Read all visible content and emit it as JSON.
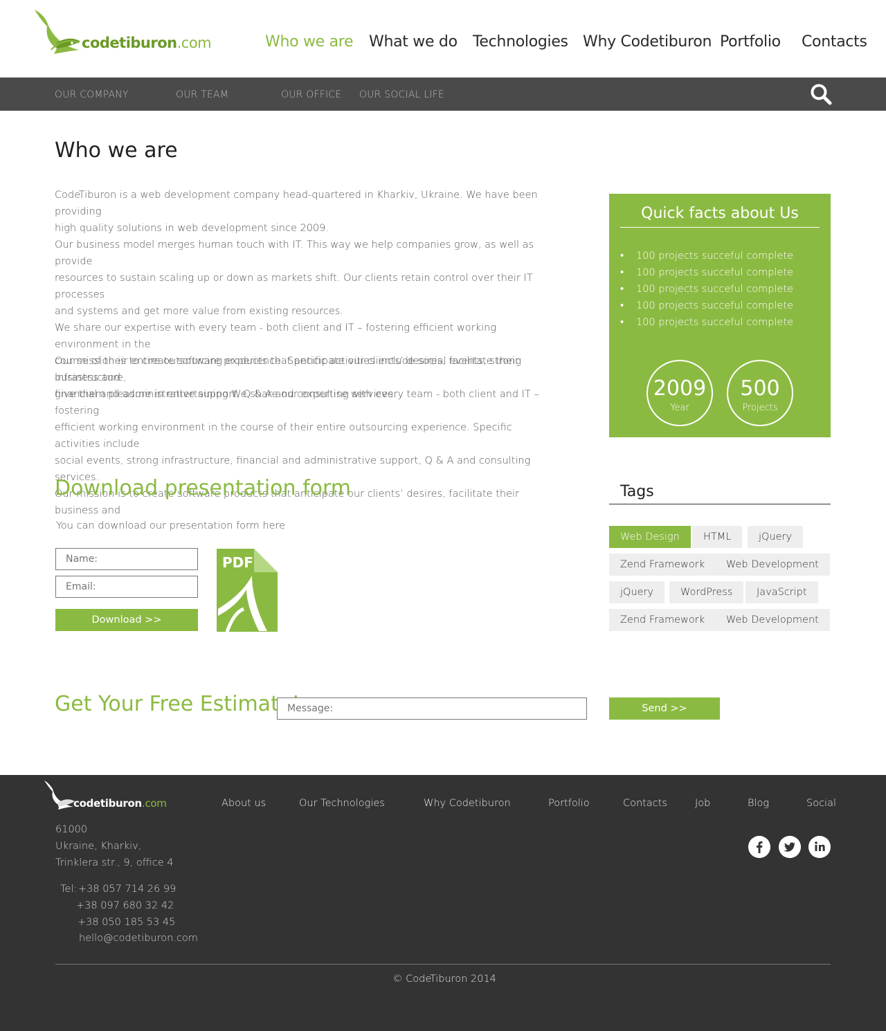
{
  "header": {
    "logo": {
      "bold": "codetiburon",
      "light": ".com"
    },
    "nav": [
      {
        "label": "Who we are",
        "active": true
      },
      {
        "label": "What we do"
      },
      {
        "label": "Technologies"
      },
      {
        "label": "Why Codetiburon"
      },
      {
        "label": "Portfolio"
      },
      {
        "label": "Contacts"
      }
    ]
  },
  "subnav": {
    "items": [
      "OUR COMPANY",
      "OUR TEAM",
      "OUR OFFICE",
      "OUR SOCIAL LIFE"
    ],
    "search_icon": "search-icon"
  },
  "main": {
    "title": "Who we are",
    "paragraphs": [
      [
        "CodeTiburon is a web development company head-quartered in Kharkiv, Ukraine. We have been providing",
        "high quality solutions in web development since 2009."
      ],
      [
        "Our business model merges human touch with IT. This way we help companies grow, as well as provide",
        "resources to sustain scaling up or down as markets shift. Our clients retain control over their IT processes",
        "and systems and get more value from existing resources.",
        "We share our expertise with every team - both client and IT – fostering efficient working environment in the",
        "course of their entire outsourcing experience. Specific activities include social events, strong infrastructure,",
        "financial and administrative support, Q & A and consulting services."
      ],
      [
        "Our mission is to create software products that anticipate our clients’ desires, facilitate their business and",
        "give them pleasure in entertaining.We share our expertise with every team - both client and IT – fostering",
        "efficient working environment in the course of their entire outsourcing experience. Specific activities include",
        "social events, strong infrastructure, financial and administrative support, Q & A and consulting services.",
        "Our mission is to create software products that anticipate our clients’ desires, facilitate their business and"
      ]
    ]
  },
  "facts": {
    "title": "Quick facts about Us",
    "items": [
      "100 projects succeful complete",
      "100 projects succeful complete",
      "100 projects succeful complete",
      "100 projects succeful complete",
      "100 projects succeful complete"
    ],
    "stats": [
      {
        "value": "2009",
        "label": "Year"
      },
      {
        "value": "500",
        "label": "Projects"
      }
    ]
  },
  "download": {
    "title": "Download presentation form",
    "text": "You can download our presentation form  here",
    "name_placeholder": "Name:",
    "email_placeholder": "Email:",
    "button": "Download >>",
    "pdf_label": "PDF"
  },
  "tags": {
    "title": "Tags",
    "items": [
      "Web Design",
      "HTML",
      "jQuery",
      "Zend Framework",
      "Web Development",
      "jQuery",
      "WordPress",
      "JavaScript",
      "Zend Framework",
      "Web Development"
    ],
    "active_index": 0
  },
  "estimate": {
    "title": "Get Your Free Estimate!",
    "message_placeholder": "Message:",
    "button": "Send >>"
  },
  "footer": {
    "logo": {
      "bold": "codetiburon",
      "light": ".com"
    },
    "nav": [
      "About us",
      "Our Technologies",
      "Why Codetiburon",
      "Portfolio",
      "Contacts",
      "Job",
      "Blog",
      "Social"
    ],
    "address": [
      "61000",
      "Ukraine, Kharkiv,",
      "Trinklera str., 9, office 4"
    ],
    "phone_label": "Tel:",
    "phones": [
      "+38 057 714 26 99",
      "+38 097 680 32 42",
      "+38 050 185 53 45"
    ],
    "email": "hello@codetiburon.com",
    "social": [
      "facebook-icon",
      "twitter-icon",
      "linkedin-icon"
    ],
    "copyright": "© CodeTiburon 2014"
  },
  "colors": {
    "accent": "#8bba42",
    "subnav_bg": "#4a4a4a",
    "footer_bg": "#333333"
  }
}
